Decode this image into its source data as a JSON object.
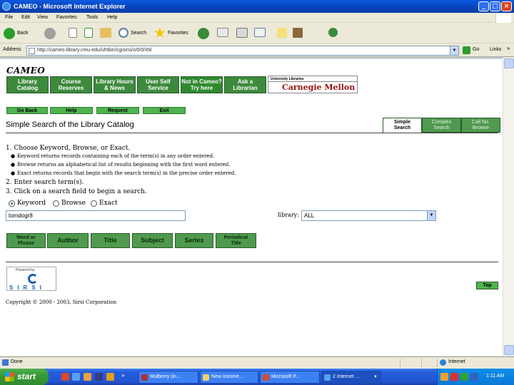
{
  "window": {
    "title": "CAMEO - Microsoft Internet Explorer"
  },
  "menu": [
    "File",
    "Edit",
    "View",
    "Favorites",
    "Tools",
    "Help"
  ],
  "toolbar": {
    "back": "Back",
    "search": "Search",
    "favorites": "Favorites"
  },
  "address": {
    "label": "Address",
    "url": "http://cameo.library.cmu.edu/uhtbin/cgisirsi/x/0/0/49/",
    "go": "Go",
    "links": "Links"
  },
  "logo": "CAMEO",
  "nav": [
    "Library\nCatalog",
    "Course\nReserves",
    "Library Hours\n& News",
    "User Self\nService",
    "Not in Cameo?\nTry here",
    "Ask a\nLibrarian"
  ],
  "cmu": {
    "small": "University Libraries",
    "big": "Carnegie Mellon"
  },
  "subnav": [
    "Go Back",
    "Help",
    "Request",
    "Exit"
  ],
  "page_title": "Simple Search of the Library Catalog",
  "tabs": [
    "Simple\nSearch",
    "Complex\nSearch",
    "Call No.\nBrowse"
  ],
  "instructions": {
    "step1": "1. Choose Keyword, Browse, or Exact.",
    "bullets": [
      "Keyword returns records containing each of the term(s) in any order entered.",
      "Browse returns an alphabetical list of results beginning with the first word entered.",
      "Exact returns records that begin with the search term(s) in the precise order entered."
    ],
    "step2": "2. Enter search term(s).",
    "step3": "3. Click on a search field to begin a search."
  },
  "search_modes": {
    "keyword": "Keyword",
    "browse": "Browse",
    "exact": "Exact",
    "selected": "keyword"
  },
  "search_value": "tomdogr8",
  "library": {
    "label": "library:",
    "selected": "ALL"
  },
  "fields": [
    "Word or\nPhrase",
    "Author",
    "Title",
    "Subject",
    "Series",
    "Periodical\nTitle"
  ],
  "sirsi": {
    "powered": "Powered by:",
    "name": "SIRSI"
  },
  "top_label": "Top",
  "copyright": "Copyright © 2000 - 2003, Sirsi Corporation",
  "status": {
    "left": "Done",
    "zone": "Internet"
  },
  "taskbar": {
    "start": "start",
    "tasks": [
      "Mulberry (in...",
      "New Income...",
      "Microsoft P...",
      "2 Internet ..."
    ],
    "clock": "1:11 AM"
  },
  "colors": {
    "title_bar": "#0a5ae0",
    "nav_green": "#3d8a3d",
    "button_green": "#4fb34f",
    "cmu_red": "#9a1010"
  }
}
